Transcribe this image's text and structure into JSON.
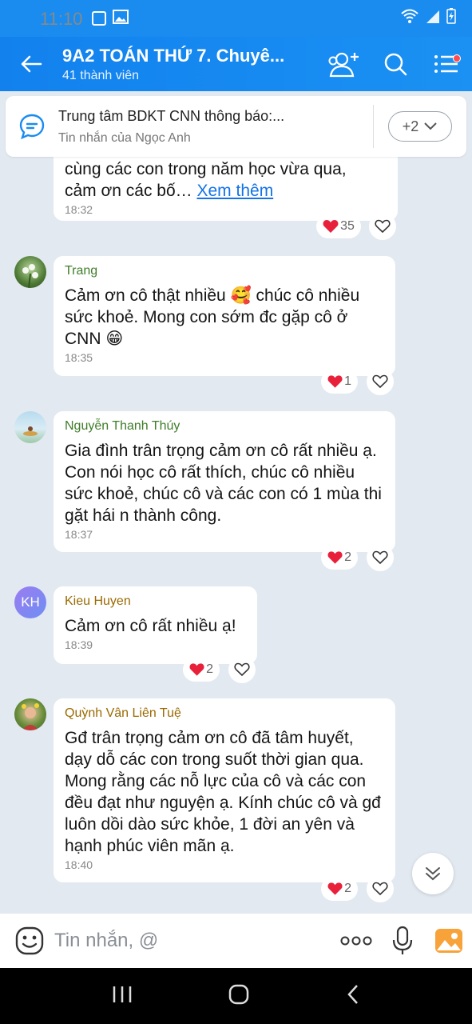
{
  "status_bar": {
    "time": "11:10"
  },
  "header": {
    "title": "9A2 TOÁN THỨ 7. Chuyê...",
    "subtitle": "41 thành viên"
  },
  "pinned": {
    "title": "Trung tâm BDKT CNN thông báo:...",
    "subtitle": "Tin nhắn của Ngọc Anh",
    "more_label": "+2"
  },
  "messages": [
    {
      "sender": "",
      "text": "cùng các con trong năm học vừa qua,\ncảm ơn các bố… ",
      "more_link": "Xem thêm",
      "time": "18:32",
      "reaction_count": "35"
    },
    {
      "sender": "Trang",
      "text": "Cảm ơn cô thật nhiều 🥰 chúc cô nhiều sức khoẻ. Mong con sớm đc gặp cô ở CNN 😁",
      "time": "18:35",
      "reaction_count": "1"
    },
    {
      "sender": "Nguyễn Thanh Thúy",
      "text": "Gia đình trân trọng cảm ơn cô rất nhiều ạ. Con nói học cô rất thích, chúc cô nhiều sức khoẻ, chúc cô và các con có 1 mùa thi gặt hái n thành công.",
      "time": "18:37",
      "reaction_count": "2"
    },
    {
      "sender": "Kieu Huyen",
      "avatar_initials": "KH",
      "text": "Cảm ơn cô rất nhiều ạ!",
      "time": "18:39",
      "reaction_count": "2"
    },
    {
      "sender": "Quỳnh Vân Liên Tuệ",
      "text": "Gđ trân trọng cảm ơn cô đã tâm huyết, dạy dỗ các con trong suốt thời gian qua. Mong rằng các nỗ lực của cô và các con đều đạt như nguyện ạ. Kính chúc cô và gđ luôn dồi dào sức khỏe, 1 đời an yên và hạnh phúc viên mãn ạ.",
      "time": "18:40",
      "reaction_count": "2"
    }
  ],
  "input": {
    "placeholder": "Tin nhắn, @"
  },
  "colors": {
    "header": "#1a8cf0",
    "sender_green": "#3f7d2a",
    "sender_brown": "#9a6a00",
    "link": "#1473e6",
    "heart": "#e8203a"
  }
}
